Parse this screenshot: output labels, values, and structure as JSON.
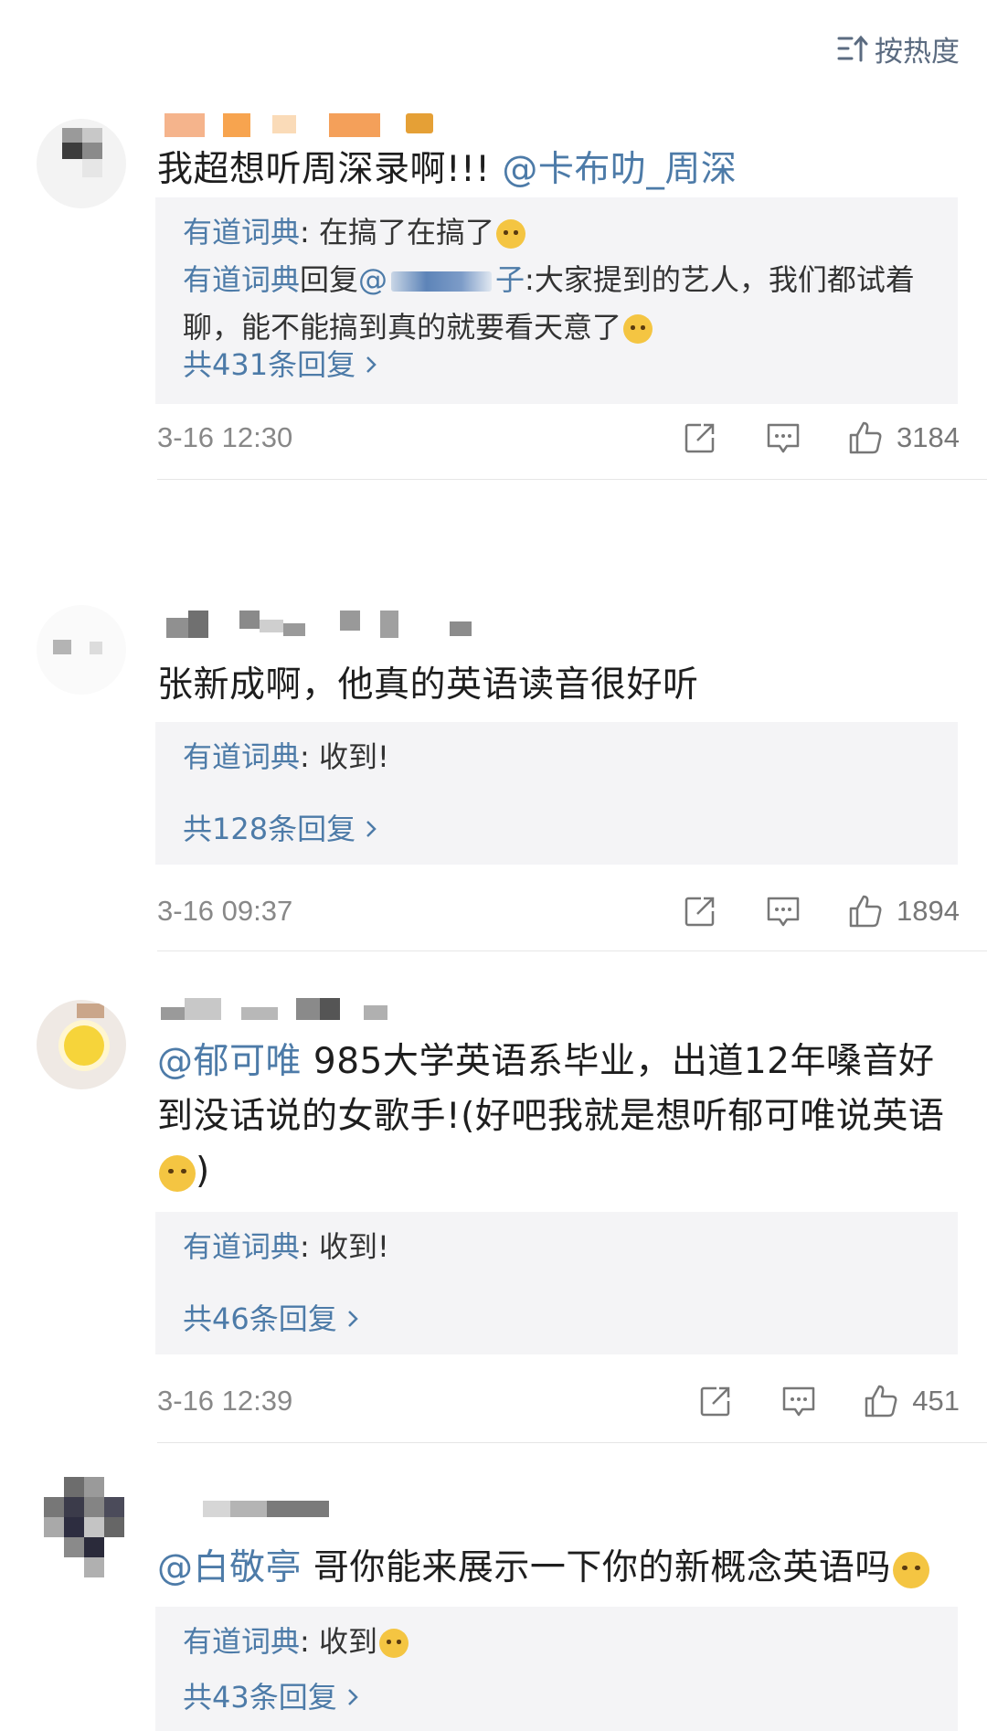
{
  "sort": {
    "label": "按热度",
    "icon": "sort-icon"
  },
  "colors": {
    "link": "#4d7ba8",
    "reply_bg": "#f4f4f6",
    "meta": "#888888"
  },
  "comments": [
    {
      "text": "我超想听周深录啊!!! ",
      "mention": "@卡布叻_周深",
      "replies": [
        {
          "author": "有道词典",
          "sep": ": ",
          "text": "在搞了在搞了",
          "emoji": "sad-face-emoji"
        },
        {
          "author": "有道词典",
          "mid": "回复",
          "to_pre": "@",
          "to_post": "子",
          "text": ":大家提到的艺人，我们都试着聊，能不能搞到真的就要看天意了",
          "emoji": "doge-emoji"
        }
      ],
      "more": "共431条回复",
      "time": "3-16 12:30",
      "likes": "3184"
    },
    {
      "text": "张新成啊，他真的英语读音很好听",
      "replies": [
        {
          "author": "有道词典",
          "sep": ": ",
          "text": "收到!"
        }
      ],
      "more": "共128条回复",
      "time": "3-16 09:37",
      "likes": "1894"
    },
    {
      "mention": "@郁可唯",
      "text": " 985大学英语系毕业，出道12年嗓音好到没话说的女歌手!(好吧我就是想听郁可唯说英语",
      "tail": ")",
      "replies": [
        {
          "author": "有道词典",
          "sep": ": ",
          "text": "收到!"
        }
      ],
      "more": "共46条回复",
      "time": "3-16 12:39",
      "likes": "451"
    },
    {
      "mention": "@白敬亭",
      "text": " 哥你能来展示一下你的新概念英语吗",
      "replies": [
        {
          "author": "有道词典",
          "sep": ": ",
          "text": "收到",
          "emoji": "doge-emoji"
        }
      ],
      "more": "共43条回复"
    }
  ]
}
